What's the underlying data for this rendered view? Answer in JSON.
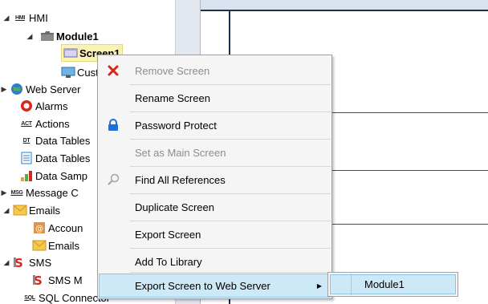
{
  "tree": {
    "items": [
      {
        "label": "HMI",
        "icon": "hmi-icon",
        "expanded": true
      },
      {
        "label": "Module1",
        "icon": "folder-icon",
        "expanded": true
      },
      {
        "label": "Screen1",
        "icon": "screen-icon",
        "selected": true
      },
      {
        "label": "Custom",
        "icon": "custom-screen-icon"
      },
      {
        "label": "Web Server",
        "icon": "globe-icon",
        "expandable": true
      },
      {
        "label": "Alarms",
        "icon": "alarm-icon"
      },
      {
        "label": "Actions",
        "icon": "actions-icon"
      },
      {
        "label": "Data Tables",
        "icon": "data-table-icon"
      },
      {
        "label": "Data Tables",
        "icon": "data-table-file-icon"
      },
      {
        "label": "Data Samp",
        "icon": "bar-chart-icon"
      },
      {
        "label": "Message C",
        "icon": "message-icon",
        "expandable": true
      },
      {
        "label": "Emails",
        "icon": "envelope-icon",
        "expanded": true
      },
      {
        "label": "Accoun",
        "icon": "account-icon"
      },
      {
        "label": "Emails",
        "icon": "envelope-icon"
      },
      {
        "label": "SMS",
        "icon": "sms-icon",
        "expanded": true
      },
      {
        "label": "SMS M",
        "icon": "sms-icon"
      },
      {
        "label": "SQL Connector",
        "icon": "sql-icon"
      }
    ],
    "tags": {
      "hmi": "HMI",
      "act": "ACT",
      "dt": "DT",
      "msg": "MSG",
      "sql": "SQL"
    }
  },
  "context_menu": {
    "items": [
      {
        "label": "Remove Screen",
        "icon": "red-x-icon",
        "disabled": true
      },
      {
        "label": "Rename Screen",
        "disabled": false
      },
      {
        "label": "Password Protect",
        "icon": "lock-icon",
        "disabled": false
      },
      {
        "label": "Set as Main Screen",
        "disabled": true
      },
      {
        "label": "Find All References",
        "icon": "magnifier-icon",
        "disabled": false
      },
      {
        "label": "Duplicate Screen",
        "disabled": false
      },
      {
        "label": "Export Screen",
        "disabled": false
      },
      {
        "label": "Add To Library",
        "disabled": false
      },
      {
        "label": "Export Screen to Web Server",
        "has_submenu": true,
        "highlighted": true
      }
    ]
  },
  "submenu": {
    "items": [
      {
        "label": "Module1",
        "highlighted": true
      }
    ]
  },
  "colors": {
    "highlight": "#cde8f7",
    "highlight_border": "#8fc3e5",
    "selected_tree": "#fbf3b5",
    "red_x": "#d9261c",
    "lock_blue": "#1e6fd9"
  }
}
